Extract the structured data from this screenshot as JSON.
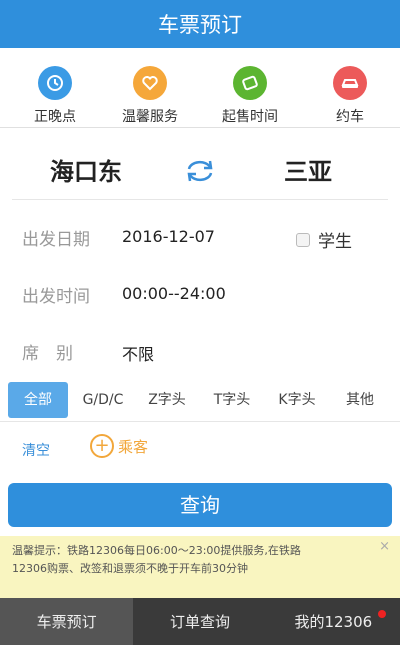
{
  "header": {
    "title": "车票预订"
  },
  "quick_menu": [
    {
      "label": "正晚点",
      "icon": "clock-icon",
      "color": "#3b9be5"
    },
    {
      "label": "温馨服务",
      "icon": "heart-icon",
      "color": "#f5a73a"
    },
    {
      "label": "起售时间",
      "icon": "ticket-icon",
      "color": "#5cb531"
    },
    {
      "label": "约车",
      "icon": "car-icon",
      "color": "#ec5a5a"
    }
  ],
  "stations": {
    "from": "海口东",
    "to": "三亚"
  },
  "form": {
    "date_label": "出发日期",
    "date_value": "2016-12-07",
    "student_label": "学生",
    "time_label": "出发时间",
    "time_value": "00:00--24:00",
    "seat_label": "席　别",
    "seat_value": "不限"
  },
  "train_types": [
    "全部",
    "G/D/C",
    "Z字头",
    "T字头",
    "K字头",
    "其他"
  ],
  "passengers": {
    "clear_label": "清空",
    "add_label": "乘客"
  },
  "query_button": "查询",
  "notice": {
    "line1": "温馨提示：铁路12306每日06:00～23:00提供服务,在铁路",
    "line2": "12306购票、改签和退票须不晚于开车前30分钟"
  },
  "tabs": [
    "车票预订",
    "订单查询",
    "我的12306"
  ],
  "colors": {
    "primary": "#2f8fdc",
    "accent": "#f2a73b",
    "badge": "#e22222"
  }
}
